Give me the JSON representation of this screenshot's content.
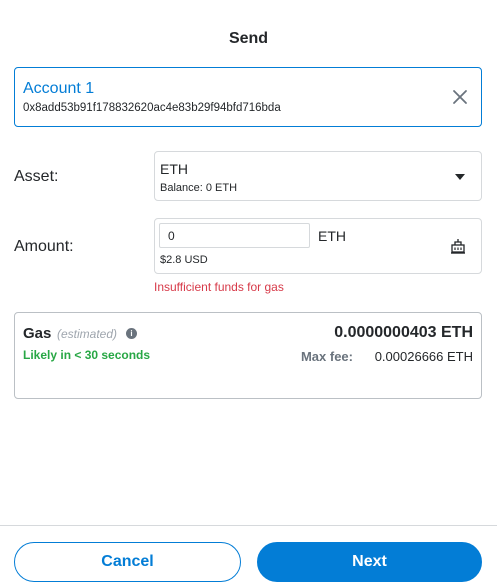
{
  "header": {
    "title": "Send"
  },
  "recipient": {
    "name": "Account 1",
    "address": "0x8add53b91f178832620ac4e83b29f94bfd716bda",
    "clear_icon": "close-icon"
  },
  "asset": {
    "label": "Asset:",
    "symbol": "ETH",
    "balance": "Balance: 0 ETH",
    "dropdown_icon": "caret-down-icon"
  },
  "amount": {
    "label": "Amount:",
    "value": "0",
    "unit": "ETH",
    "fiat": "$2.8 USD",
    "max_icon": "max-amount-icon",
    "error": "Insufficient funds for gas"
  },
  "gas": {
    "title": "Gas",
    "estimated": "(estimated)",
    "info_icon": "info-icon",
    "timing": "Likely in < 30 seconds",
    "amount": "0.0000000403 ETH",
    "max_fee_label": "Max fee:",
    "max_fee_value": "0.00026666 ETH"
  },
  "footer": {
    "cancel_label": "Cancel",
    "next_label": "Next"
  },
  "colors": {
    "primary": "#037dd6",
    "error": "#d73a49",
    "success": "#28a745",
    "text": "#24272a",
    "muted": "#9fa6ae"
  }
}
